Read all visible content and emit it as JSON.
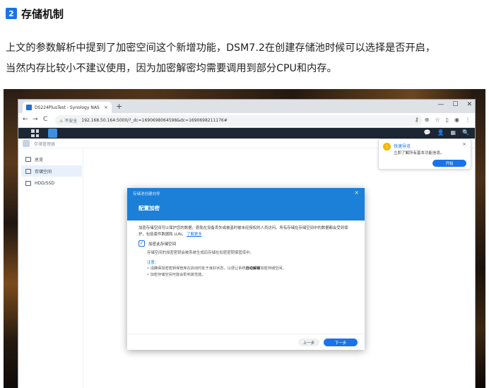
{
  "article": {
    "section_number": "2",
    "section_title": "存储机制",
    "paragraph_line1": "上文的参数解析中提到了加密空间这个新增功能，DSM7.2在创建存储池时候可以选择是否开启，",
    "paragraph_line2": "当然内存比较小不建议使用，因为加密解密均需要调用到部分CPU和内存。"
  },
  "browser": {
    "tab_title": "DS224PlusTest - Synology NAS",
    "tab_close": "×",
    "new_tab": "+",
    "window_controls": [
      "—",
      "☐",
      "✕"
    ],
    "nav_back": "←",
    "nav_forward": "→",
    "nav_reload": "C",
    "security_label": "⚠ 不安全",
    "url": "192.168.50.164:5000/?_dc=1690698064598&dc=1690698211176#",
    "addr_icons": [
      "⚷",
      "⊕",
      "☆",
      "▯",
      "◉",
      "⋮"
    ]
  },
  "dsm": {
    "top_icons": [
      "💬",
      "👤",
      "▦",
      "🔍"
    ],
    "app_title": "存储管理器",
    "sidebar": [
      {
        "label": "总览",
        "active": false
      },
      {
        "label": "存储空间",
        "active": true
      },
      {
        "label": "HDD/SSD",
        "active": false
      }
    ]
  },
  "notification": {
    "title": "快速导览",
    "text": "立即了解所有基本功能信息。",
    "close": "×",
    "button": "开始"
  },
  "dialog": {
    "caption": "存储池创建向导",
    "close": "×",
    "title": "配置加密",
    "desc_line1": "加密存储空间可以保护您的数据，避免在设备丢失或被盗时被未经授权的人员访问。所有存储在存储空间中的数据都会受到保",
    "desc_line2": "护，包括套件数据和 LUN。",
    "desc_link": "了解更多",
    "checkbox_label": "加密此存储空间",
    "checkbox_checked": true,
    "checkbox_sub": "存储空间的加密密钥会被系统生成后存储在加密密钥保管库中。",
    "note_title": "注意：",
    "note_1_pre": "• 请确保加密密钥保管库在启动时处于良好状态，以便让系统",
    "note_1_bold": "自动解锁",
    "note_1_post": "加密存储空间。",
    "note_2": "• 加密存储空间可能会影响其性能。",
    "btn_prev": "上一步",
    "btn_next": "下一步"
  }
}
